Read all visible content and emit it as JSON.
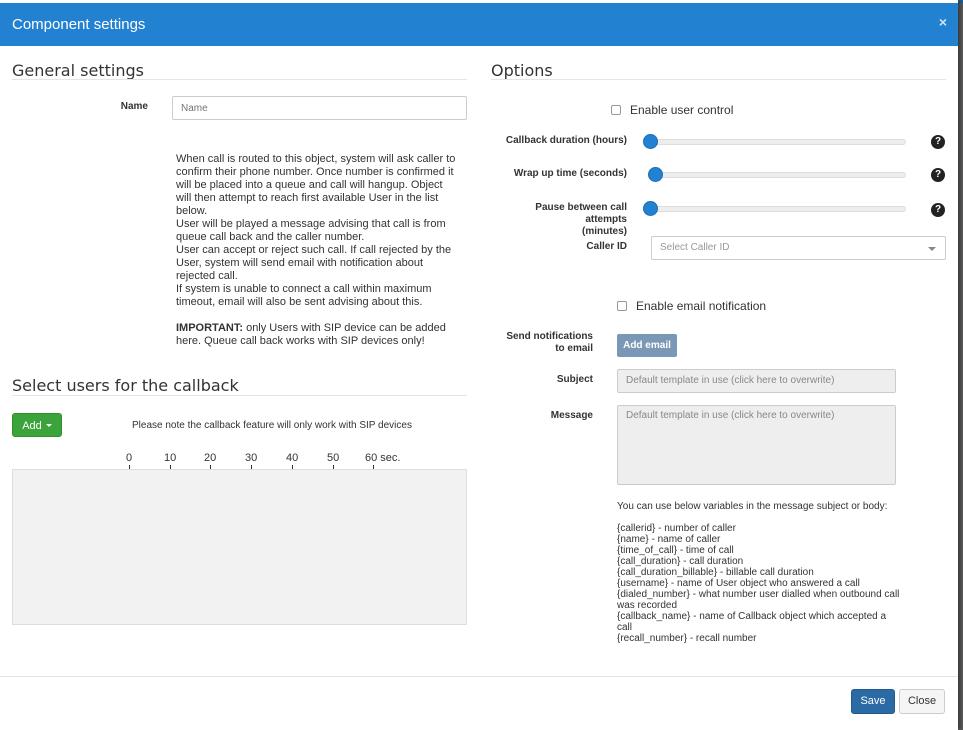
{
  "modal": {
    "title": "Component settings",
    "close_glyph": "×"
  },
  "general": {
    "title": "General settings",
    "name_label": "Name",
    "name_placeholder": "Name",
    "description_lines": [
      "When call is routed to this object, system will ask caller to confirm their phone number. Once number is confirmed it will be placed into a queue and call will hangup. Object will then attempt to reach first available User in the list below.",
      "User will be played a message advising that call is from queue call back and the caller number.",
      "User can accept or reject such call. If call rejected by the User, system will send email with notification about rejected call.",
      "If system is unable to connect a call within maximum timeout, email will also be sent advising about this."
    ],
    "important_label": "IMPORTANT:",
    "important_text": " only Users with SIP device can be added here. Queue call back works with SIP devices only!"
  },
  "users": {
    "title": "Select users for the callback",
    "add_label": "Add",
    "note": "Please note the callback feature will only work with SIP devices",
    "ticks": [
      "0",
      "10",
      "20",
      "30",
      "40",
      "50",
      "60 sec."
    ]
  },
  "options": {
    "title": "Options",
    "enable_user_control": "Enable user control",
    "callback_duration_label": "Callback duration (hours)",
    "callback_duration_level": 0,
    "wrap_up_label": "Wrap up time (seconds)",
    "wrap_up_level": 0.02,
    "pause_label_line1": "Pause between call attempts",
    "pause_label_line2": "(minutes)",
    "pause_level": 0,
    "help_glyph": "?",
    "caller_id_label": "Caller ID",
    "caller_id_placeholder": "Select Caller ID",
    "enable_email": "Enable email notification",
    "send_to_label_line1": "Send notifications",
    "send_to_label_line2": "to email",
    "add_email_label": "Add email",
    "subject_label": "Subject",
    "subject_placeholder": "Default template in use (click here to overwrite)",
    "message_label": "Message",
    "message_placeholder": "Default template in use (click here to overwrite)",
    "vars_intro": "You can use below variables in the message subject or body:",
    "vars": [
      "{callerid} - number of caller",
      "{name} - name of caller",
      "{time_of_call} - time of call",
      "{call_duration} - call duration",
      "{call_duration_billable} - billable call duration",
      "{username} - name of User object who answered a call",
      "{dialed_number} - what number user dialled when outbound call was recorded",
      "{callback_name} - name of Callback object which accepted a call",
      "{recall_number} - recall number"
    ]
  },
  "footer": {
    "save_label": "Save",
    "close_label": "Close"
  },
  "colors": {
    "header": "#2281d1",
    "primary": "#2b6aa4",
    "success": "#3aa43a"
  }
}
